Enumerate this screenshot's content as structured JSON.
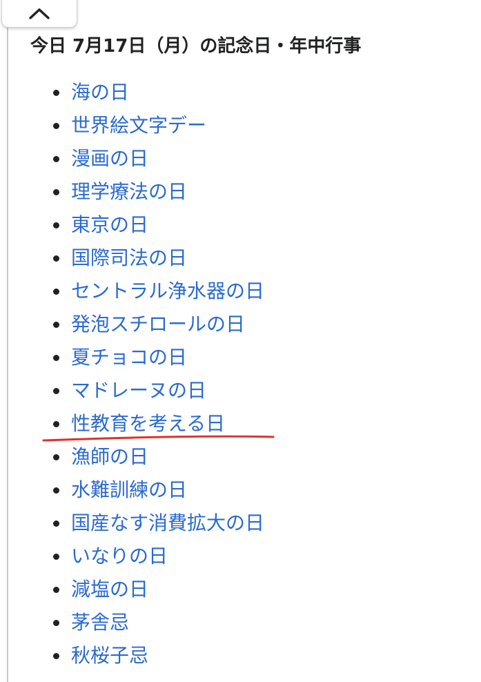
{
  "section": {
    "title": "今日 7月17日（月）の記念日・年中行事"
  },
  "events": [
    {
      "label": "海の日"
    },
    {
      "label": "世界絵文字デー"
    },
    {
      "label": "漫画の日"
    },
    {
      "label": "理学療法の日"
    },
    {
      "label": "東京の日"
    },
    {
      "label": "国際司法の日"
    },
    {
      "label": "セントラル浄水器の日"
    },
    {
      "label": "発泡スチロールの日"
    },
    {
      "label": "夏チョコの日"
    },
    {
      "label": "マドレーヌの日"
    },
    {
      "label": "性教育を考える日"
    },
    {
      "label": "漁師の日"
    },
    {
      "label": "水難訓練の日"
    },
    {
      "label": "国産なす消費拡大の日"
    },
    {
      "label": "いなりの日"
    },
    {
      "label": "減塩の日"
    },
    {
      "label": "茅舎忌"
    },
    {
      "label": "秋桜子忌"
    }
  ],
  "colors": {
    "link": "#2a6ad0",
    "text": "#202122",
    "highlight_stroke": "#e0302a"
  },
  "icons": {
    "collapse": "chevron-up-icon"
  }
}
